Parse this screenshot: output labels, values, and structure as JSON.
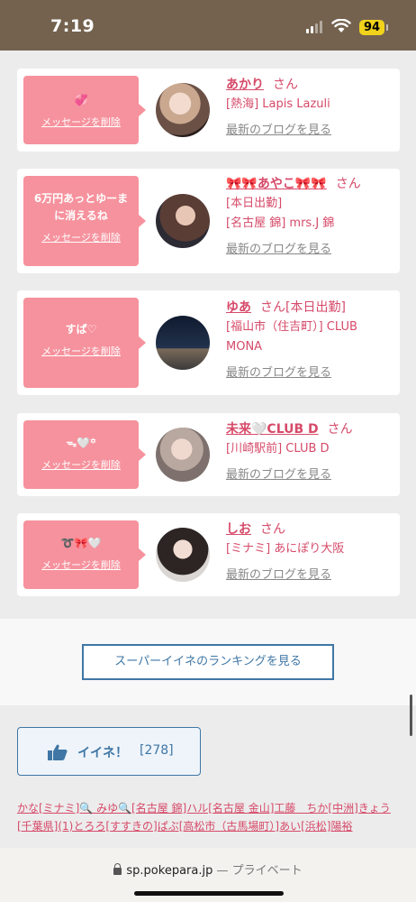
{
  "status": {
    "time": "7:19",
    "battery": "94"
  },
  "cards": [
    {
      "message": "💞",
      "delete_label": "メッセージを削除",
      "name": "あかり",
      "honorific": "さん",
      "shop_lines": [
        "[熱海] Lapis Lazuli"
      ],
      "blog_label": "最新のブログを見る"
    },
    {
      "message": "6万円あっとゆーまに消えるね",
      "delete_label": "メッセージを削除",
      "name": "🎀🎀あやこ🎀🎀",
      "honorific": "さん",
      "shop_lines": [
        "[本日出勤]",
        "[名古屋 錦] mrs.J 錦"
      ],
      "blog_label": "最新のブログを見る"
    },
    {
      "message": "すぱ♡",
      "delete_label": "メッセージを削除",
      "name": "ゆあ",
      "honorific": "さん[本日出勤]",
      "shop_lines": [
        "[福山市（住吉町）] CLUB MONA"
      ],
      "blog_label": "最新のブログを見る"
    },
    {
      "message": "ᯓ🤍꙳",
      "delete_label": "メッセージを削除",
      "name": "未来🤍CLUB D",
      "honorific": "さん",
      "shop_lines": [
        "[川崎駅前] CLUB D"
      ],
      "blog_label": "最新のブログを見る"
    },
    {
      "message": "➰🎀🤍",
      "delete_label": "メッセージを削除",
      "name": "しお",
      "honorific": "さん",
      "shop_lines": [
        "[ミナミ] あにぽり大阪"
      ],
      "blog_label": "最新のブログを見る"
    }
  ],
  "ranking_button": "スーパーイイネのランキングを見る",
  "like": {
    "label": "イイネ！",
    "count": "[278]"
  },
  "liked_names": "かな[ミナミ]🔍 みゆ🔍[名古屋 錦]ハル[名古屋 金山]工藤　ちか[中洲]きょう[千葉県](1)とろろ[すすきの]ぱぶ[高松市（古馬場町）]あい[浜松]陽裕",
  "url_bar": {
    "domain": "sp.pokepara.jp",
    "suffix": " — プライベート"
  },
  "colors": {
    "accent_pink": "#f6929d",
    "name_pink": "#d64a69",
    "link_blue": "#3f76a5",
    "status_bar": "#74624f"
  }
}
